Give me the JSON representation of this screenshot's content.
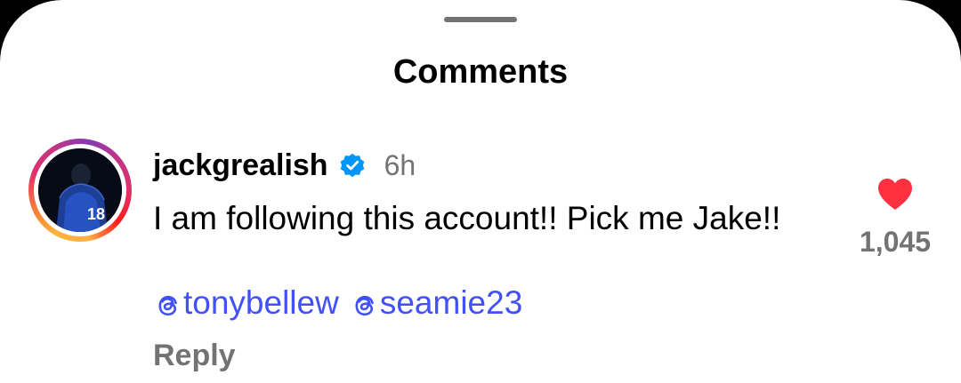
{
  "sheet": {
    "title": "Comments"
  },
  "comment": {
    "username": "jackgrealish",
    "verified": true,
    "time": "6h",
    "text": "I am following this account!! Pick me Jake!!",
    "mentions": [
      {
        "handle": "tonybellew",
        "icon": "threads-icon"
      },
      {
        "handle": "seamie23",
        "icon": "threads-icon"
      }
    ],
    "reply_label": "Reply",
    "likes": "1,045",
    "liked": true,
    "avatar_jersey_number": "18"
  },
  "colors": {
    "like_red": "#ff3040",
    "mention_blue": "#4150f7",
    "verified_blue": "#0095f6",
    "secondary_text": "#737373"
  }
}
